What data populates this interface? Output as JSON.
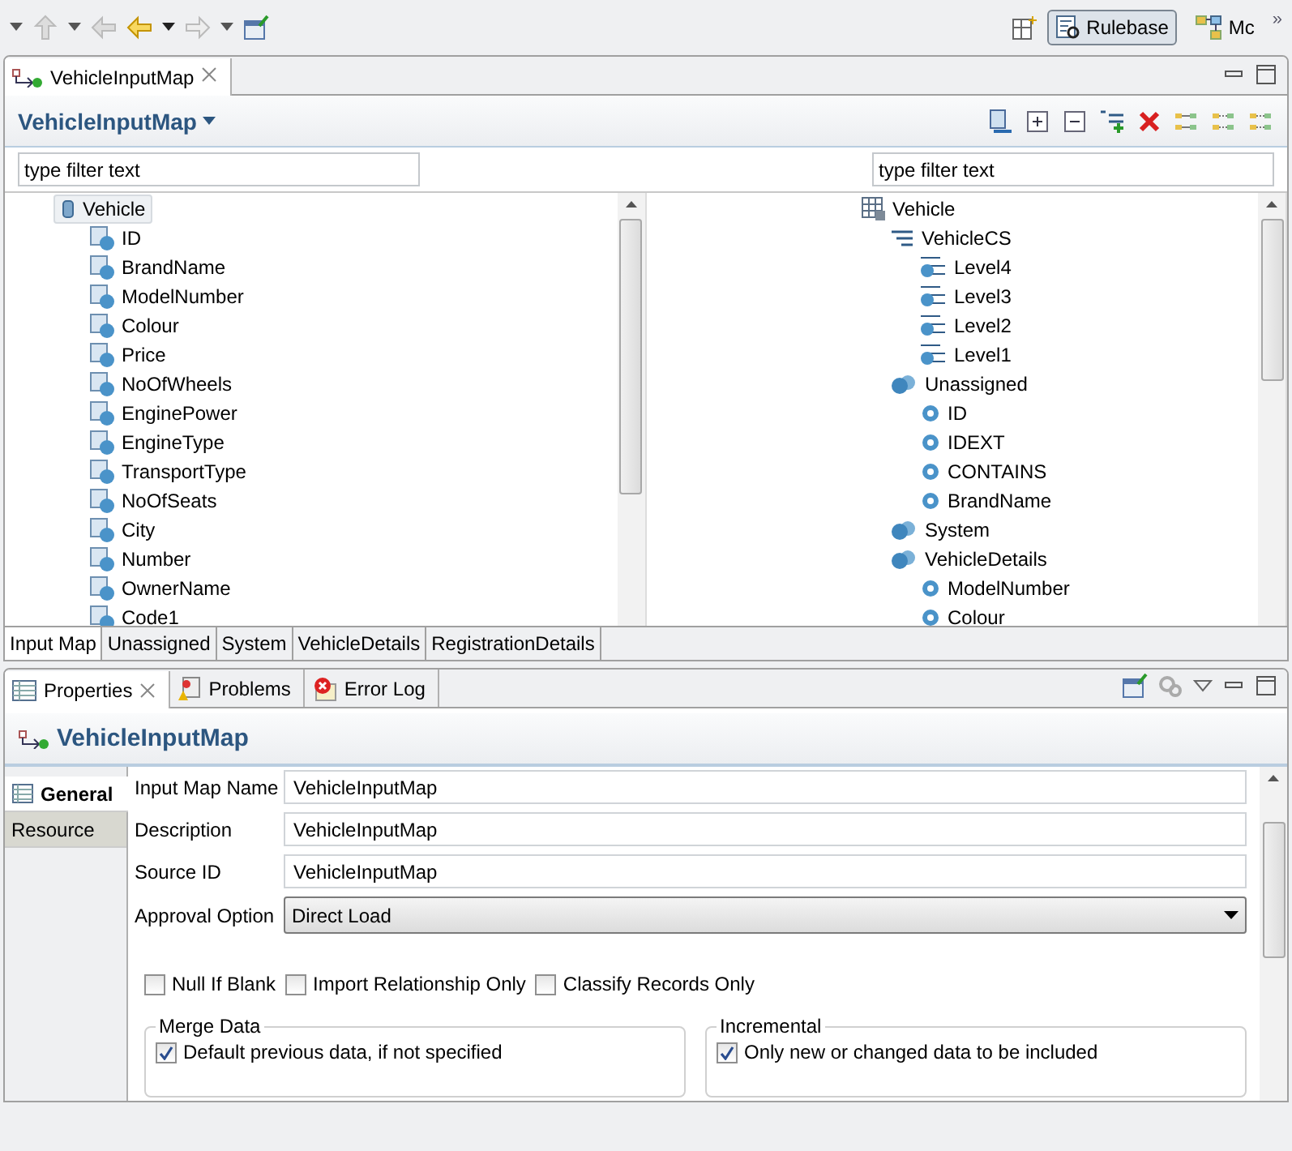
{
  "perspectives": [
    {
      "label": "Rulebase",
      "selected": true,
      "kind": "rulebase"
    },
    {
      "label": "Mc",
      "selected": false,
      "kind": "model"
    }
  ],
  "perspective_more": "»",
  "editor": {
    "tab": "VehicleInputMap",
    "title": "VehicleInputMap",
    "left_filter": {
      "placeholder": "type filter text"
    },
    "right_filter": {
      "placeholder": "type filter text"
    },
    "left_tree": [
      {
        "label": "Vehicle",
        "kind": "entity",
        "selected": true,
        "children": [
          {
            "label": "ID",
            "kind": "attribute",
            "selected": false
          },
          {
            "label": "BrandName",
            "kind": "attribute",
            "selected": false
          },
          {
            "label": "ModelNumber",
            "kind": "attribute",
            "selected": false
          },
          {
            "label": "Colour",
            "kind": "attribute",
            "selected": false
          },
          {
            "label": "Price",
            "kind": "attribute",
            "selected": false
          },
          {
            "label": "NoOfWheels",
            "kind": "attribute",
            "selected": false
          },
          {
            "label": "EnginePower",
            "kind": "attribute",
            "selected": false
          },
          {
            "label": "EngineType",
            "kind": "attribute",
            "selected": false
          },
          {
            "label": "TransportType",
            "kind": "attribute",
            "selected": false
          },
          {
            "label": "NoOfSeats",
            "kind": "attribute",
            "selected": false
          },
          {
            "label": "City",
            "kind": "attribute",
            "selected": false
          },
          {
            "label": "Number",
            "kind": "attribute",
            "selected": false
          },
          {
            "label": "OwnerName",
            "kind": "attribute",
            "selected": false
          },
          {
            "label": "Code1",
            "kind": "attribute",
            "selected": false
          }
        ]
      }
    ],
    "right_tree": [
      {
        "label": "Vehicle",
        "kind": "table",
        "selected": false,
        "children": [
          {
            "label": "VehicleCS",
            "kind": "hierarchy",
            "selected": false,
            "children": [
              {
                "label": "Level4",
                "kind": "level",
                "selected": false
              },
              {
                "label": "Level3",
                "kind": "level",
                "selected": false
              },
              {
                "label": "Level2",
                "kind": "level",
                "selected": false
              },
              {
                "label": "Level1",
                "kind": "level",
                "selected": false
              }
            ]
          },
          {
            "label": "Unassigned",
            "kind": "group",
            "selected": false,
            "children": [
              {
                "label": "ID",
                "kind": "field",
                "selected": false
              },
              {
                "label": "IDEXT",
                "kind": "field",
                "selected": false
              },
              {
                "label": "CONTAINS",
                "kind": "field",
                "selected": false
              },
              {
                "label": "BrandName",
                "kind": "field",
                "selected": false
              }
            ]
          },
          {
            "label": "System",
            "kind": "group",
            "selected": false
          },
          {
            "label": "VehicleDetails",
            "kind": "group",
            "selected": false,
            "children": [
              {
                "label": "ModelNumber",
                "kind": "field",
                "selected": false
              },
              {
                "label": "Colour",
                "kind": "field",
                "selected": false
              }
            ]
          }
        ]
      }
    ],
    "bottom_tabs": [
      {
        "label": "Input Map",
        "selected": true
      },
      {
        "label": "Unassigned",
        "selected": false
      },
      {
        "label": "System",
        "selected": false
      },
      {
        "label": "VehicleDetails",
        "selected": false
      },
      {
        "label": "RegistrationDetails",
        "selected": false
      }
    ]
  },
  "views": {
    "tabs": [
      {
        "label": "Properties",
        "selected": true,
        "kind": "properties"
      },
      {
        "label": "Problems",
        "selected": false,
        "kind": "problems"
      },
      {
        "label": "Error Log",
        "selected": false,
        "kind": "errorlog"
      }
    ],
    "title": "VehicleInputMap",
    "side_tabs": [
      {
        "label": "General",
        "selected": true
      },
      {
        "label": "Resource",
        "selected": false
      }
    ],
    "fields": [
      {
        "label": "Input Map Name",
        "value": "VehicleInputMap"
      },
      {
        "label": "Description",
        "value": "VehicleInputMap"
      },
      {
        "label": "Source ID",
        "value": "VehicleInputMap"
      }
    ],
    "approval": {
      "label": "Approval Option",
      "value": "Direct Load"
    },
    "options": [
      {
        "label": "Null If Blank",
        "checked": false
      },
      {
        "label": "Import Relationship Only",
        "checked": false
      },
      {
        "label": "Classify Records Only",
        "checked": false
      }
    ],
    "groups": [
      {
        "title": "Merge Data",
        "option": {
          "label": "Default previous data, if not specified",
          "checked": true
        }
      },
      {
        "title": "Incremental",
        "option": {
          "label": "Only new or changed data to be included",
          "checked": true
        }
      }
    ]
  }
}
